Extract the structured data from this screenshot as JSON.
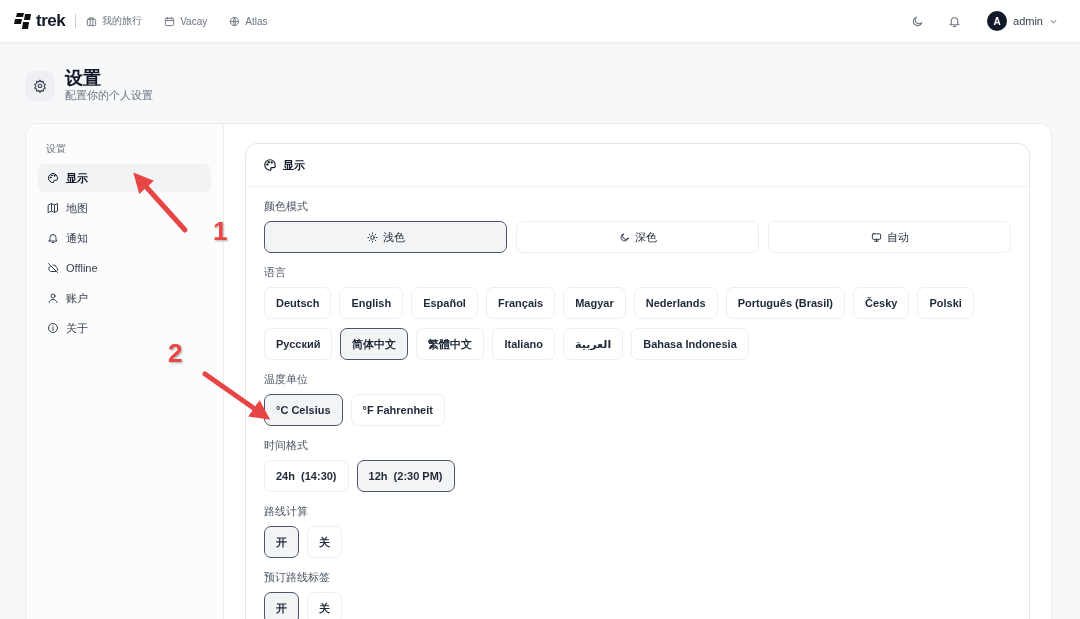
{
  "nav": {
    "logo": "trek",
    "links": [
      {
        "label": "我的旅行"
      },
      {
        "label": "Vacay"
      },
      {
        "label": "Atlas"
      }
    ],
    "user": {
      "avatar": "A",
      "name": "admin"
    }
  },
  "header": {
    "title": "设置",
    "subtitle": "配置你的个人设置"
  },
  "sidebar": {
    "heading": "设置",
    "items": [
      {
        "label": "显示",
        "selected": true
      },
      {
        "label": "地图",
        "selected": false
      },
      {
        "label": "通知",
        "selected": false
      },
      {
        "label": "Offline",
        "selected": false
      },
      {
        "label": "账户",
        "selected": false
      },
      {
        "label": "关于",
        "selected": false
      }
    ]
  },
  "panel": {
    "title": "显示",
    "sections": [
      {
        "label": "颜色模式",
        "kind": "wide",
        "options": [
          {
            "label": "浅色",
            "selected": true
          },
          {
            "label": "深色",
            "selected": false
          },
          {
            "label": "自动",
            "selected": false
          }
        ]
      },
      {
        "label": "语言",
        "kind": "chips",
        "options": [
          {
            "label": "Deutsch",
            "selected": false
          },
          {
            "label": "English",
            "selected": false
          },
          {
            "label": "Español",
            "selected": false
          },
          {
            "label": "Français",
            "selected": false
          },
          {
            "label": "Magyar",
            "selected": false
          },
          {
            "label": "Nederlands",
            "selected": false
          },
          {
            "label": "Português (Brasil)",
            "selected": false
          },
          {
            "label": "Česky",
            "selected": false
          },
          {
            "label": "Polski",
            "selected": false
          },
          {
            "label": "Русский",
            "selected": false
          },
          {
            "label": "简体中文",
            "selected": true
          },
          {
            "label": "繁體中文",
            "selected": false
          },
          {
            "label": "Italiano",
            "selected": false
          },
          {
            "label": "العربية",
            "selected": false
          },
          {
            "label": "Bahasa Indonesia",
            "selected": false
          }
        ]
      },
      {
        "label": "温度单位",
        "kind": "chips",
        "options": [
          {
            "label": "°C Celsius",
            "selected": true
          },
          {
            "label": "°F Fahrenheit",
            "selected": false
          }
        ]
      },
      {
        "label": "时间格式",
        "kind": "chips",
        "options": [
          {
            "label": "24h  (14:30)",
            "selected": false
          },
          {
            "label": "12h  (2:30 PM)",
            "selected": true
          }
        ]
      },
      {
        "label": "路线计算",
        "kind": "chips",
        "options": [
          {
            "label": "开",
            "selected": true
          },
          {
            "label": "关",
            "selected": false
          }
        ]
      },
      {
        "label": "预订路线标签",
        "kind": "chips",
        "options": [
          {
            "label": "开",
            "selected": true
          },
          {
            "label": "关",
            "selected": false
          }
        ]
      }
    ]
  },
  "annotations": [
    {
      "label": "1"
    },
    {
      "label": "2"
    }
  ]
}
